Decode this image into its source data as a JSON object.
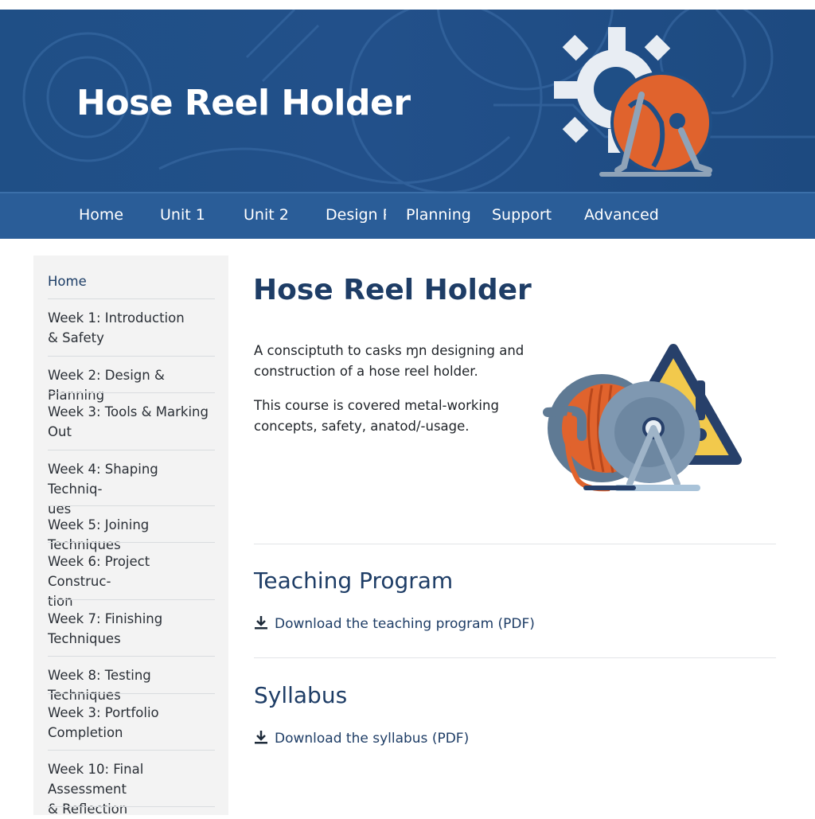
{
  "banner": {
    "title": "Hose Reel Holder",
    "logo_icon": "gear-hose-reel-logo"
  },
  "nav": {
    "items": [
      {
        "label": "Home"
      },
      {
        "label": "Unit 1"
      },
      {
        "label": "Unit 2"
      },
      {
        "label": "Design P"
      },
      {
        "label": "Planning"
      },
      {
        "label": "Support"
      },
      {
        "label": "Advanced"
      }
    ]
  },
  "sidebar": {
    "items": [
      {
        "label": "Home"
      },
      {
        "label": "Week 1: Introduction\n& Safety"
      },
      {
        "label": "Week 2: Design & Planning"
      },
      {
        "label": "Week 3: Tools & Marking\nOut"
      },
      {
        "label": "Week 4: Shaping Techniq-\nues"
      },
      {
        "label": "Week 5: Joining Techniques"
      },
      {
        "label": "Week 6: Project Construc-\ntion"
      },
      {
        "label": "Week 7: Finishing\nTechniques"
      },
      {
        "label": "Week 8: Testing Techniques"
      },
      {
        "label": "Week 3: Portfolio\nCompletion"
      },
      {
        "label": "Week 10: Final Assessment\n& Reflection"
      }
    ]
  },
  "main": {
    "title": "Hose Reel Holder",
    "intro": "A consciptuth to casks ɱn designing and construction of a hose reel holder.",
    "description": "This course is covered metal-working concepts, safety, anatod/-usage.",
    "illustration_icon": "hose-reel-warning-illustration",
    "sections": [
      {
        "title": "Teaching Program",
        "link": "Download the teaching program (PDF)",
        "icon": "download-icon"
      },
      {
        "title": "Syllabus",
        "link": "Download the syllabus (PDF)",
        "icon": "download-icon"
      }
    ]
  },
  "colors": {
    "banner": "#1f4f86",
    "nav": "#2a5d98",
    "heading": "#1e3d66",
    "accent_orange": "#e0632d",
    "warning_yellow": "#f2c94c"
  }
}
